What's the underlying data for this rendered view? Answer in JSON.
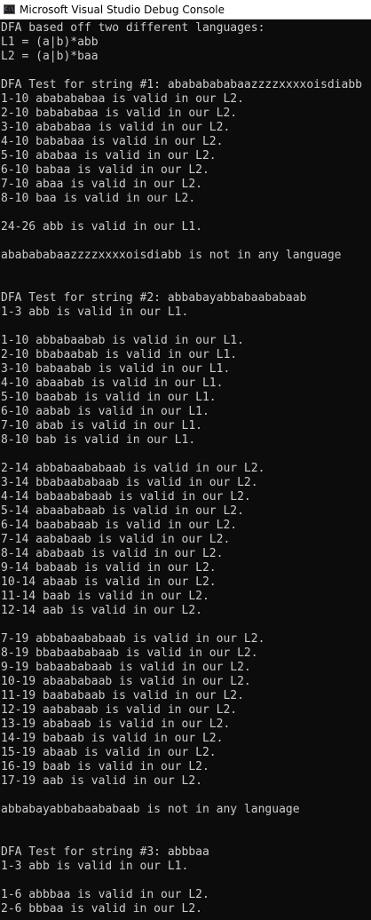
{
  "window": {
    "title": "Microsoft Visual Studio Debug Console",
    "icon": "vs-debug-console-icon"
  },
  "console": {
    "lines": [
      "DFA based off two different languages:",
      "L1 = (a|b)*abb",
      "L2 = (a|b)*baa",
      "",
      "DFA Test for string #1: abababababaazzzzxxxxoisdiabb",
      "1-10 ababababaa is valid in our L2.",
      "2-10 babababaa is valid in our L2.",
      "3-10 abababaa is valid in our L2.",
      "4-10 bababaa is valid in our L2.",
      "5-10 ababaa is valid in our L2.",
      "6-10 babaa is valid in our L2.",
      "7-10 abaa is valid in our L2.",
      "8-10 baa is valid in our L2.",
      "",
      "24-26 abb is valid in our L1.",
      "",
      "ababababaazzzzxxxxoisdiabb is not in any language",
      "",
      "",
      "DFA Test for string #2: abbabayabbabaababaab",
      "1-3 abb is valid in our L1.",
      "",
      "1-10 abbabaabab is valid in our L1.",
      "2-10 bbabaabab is valid in our L1.",
      "3-10 babaabab is valid in our L1.",
      "4-10 abaabab is valid in our L1.",
      "5-10 baabab is valid in our L1.",
      "6-10 aabab is valid in our L1.",
      "7-10 abab is valid in our L1.",
      "8-10 bab is valid in our L1.",
      "",
      "2-14 abbabaababaab is valid in our L2.",
      "3-14 bbabaababaab is valid in our L2.",
      "4-14 babaababaab is valid in our L2.",
      "5-14 abaababaab is valid in our L2.",
      "6-14 baababaab is valid in our L2.",
      "7-14 aababaab is valid in our L2.",
      "8-14 ababaab is valid in our L2.",
      "9-14 babaab is valid in our L2.",
      "10-14 abaab is valid in our L2.",
      "11-14 baab is valid in our L2.",
      "12-14 aab is valid in our L2.",
      "",
      "7-19 abbabaababaab is valid in our L2.",
      "8-19 bbabaababaab is valid in our L2.",
      "9-19 babaababaab is valid in our L2.",
      "10-19 abaababaab is valid in our L2.",
      "11-19 baababaab is valid in our L2.",
      "12-19 aababaab is valid in our L2.",
      "13-19 ababaab is valid in our L2.",
      "14-19 babaab is valid in our L2.",
      "15-19 abaab is valid in our L2.",
      "16-19 baab is valid in our L2.",
      "17-19 aab is valid in our L2.",
      "",
      "abbabayabbabaababaab is not in any language",
      "",
      "",
      "DFA Test for string #3: abbbaa",
      "1-3 abb is valid in our L1.",
      "",
      "1-6 abbbaa is valid in our L2.",
      "2-6 bbbaa is valid in our L2."
    ]
  }
}
